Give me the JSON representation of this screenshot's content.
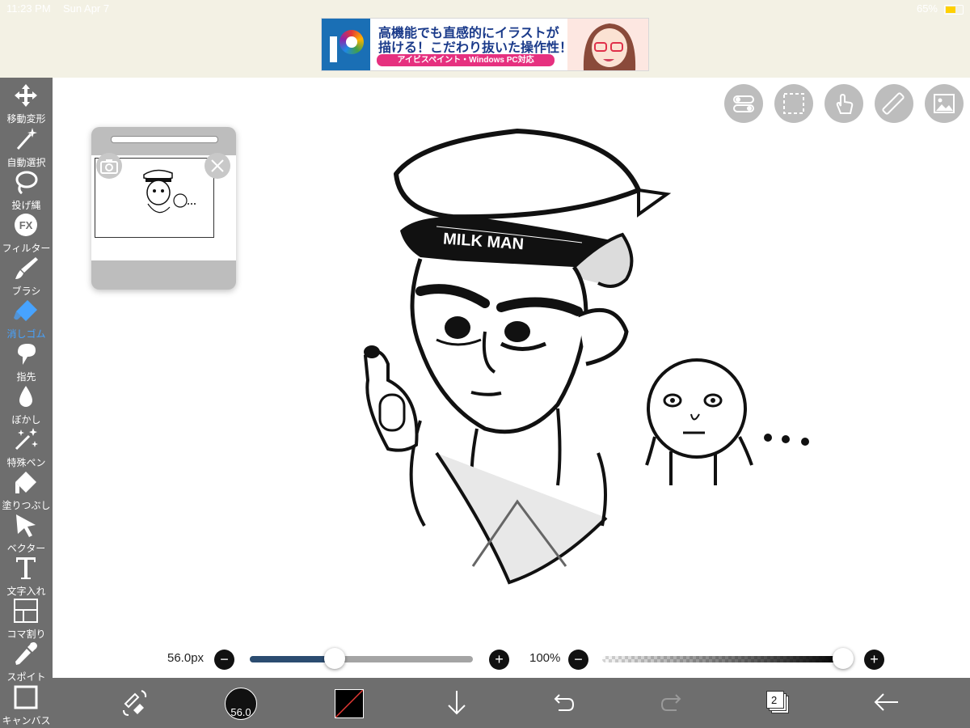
{
  "status_bar": {
    "time": "11:23 PM",
    "date": "Sun Apr 7",
    "battery": "65%"
  },
  "ad": {
    "line1": "高機能でも直感的にイラストが",
    "line2": "描ける！こだわり抜いた操作性！",
    "sub": "アイビスペイント・Windows PC対応"
  },
  "tools": [
    {
      "label": "移動変形",
      "icon": "move-icon"
    },
    {
      "label": "自動選択",
      "icon": "magic-wand-icon"
    },
    {
      "label": "投げ縄",
      "icon": "lasso-icon"
    },
    {
      "label": "フィルター",
      "icon": "filter-fx-icon"
    },
    {
      "label": "ブラシ",
      "icon": "brush-icon"
    },
    {
      "label": "消しゴム",
      "icon": "eraser-icon"
    },
    {
      "label": "指先",
      "icon": "smudge-icon"
    },
    {
      "label": "ぼかし",
      "icon": "blur-drop-icon"
    },
    {
      "label": "特殊ペン",
      "icon": "special-pen-icon"
    },
    {
      "label": "塗りつぶし",
      "icon": "fill-bucket-icon"
    },
    {
      "label": "ベクター",
      "icon": "vector-cursor-icon"
    },
    {
      "label": "文字入れ",
      "icon": "text-icon"
    },
    {
      "label": "コマ割り",
      "icon": "frame-divider-icon"
    },
    {
      "label": "スポイト",
      "icon": "eyedropper-icon"
    },
    {
      "label": "キャンバス",
      "icon": "canvas-icon"
    }
  ],
  "sliders": {
    "brush_size_label": "56.0px",
    "brush_size_fraction": 0.38,
    "opacity_label": "100%",
    "opacity_fraction": 1.0
  },
  "bottom_bar": {
    "brush_size": "56.0",
    "layer_count": "2"
  },
  "colors": {
    "accent": "#47a3ff",
    "panel": "#6e6e6e",
    "slider_fill": "#2b4c70",
    "ad_pink": "#e6307f",
    "ad_blue": "#1a6fb5"
  },
  "drawing": {
    "hat_text": "MILK MAN"
  }
}
